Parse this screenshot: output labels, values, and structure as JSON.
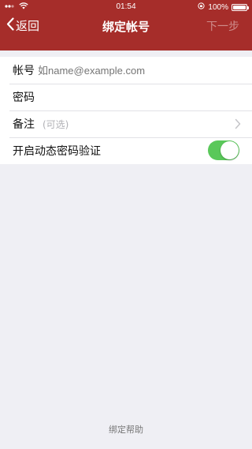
{
  "statusbar": {
    "time": "01:54",
    "battery_text": "100%"
  },
  "navbar": {
    "back_label": "返回",
    "title": "绑定帐号",
    "next_label": "下一步"
  },
  "form": {
    "account_label": "帐号",
    "account_placeholder": "如name@example.com",
    "password_label": "密码",
    "note_label": "备注",
    "note_hint": "(可选)",
    "dynamic_label": "开启动态密码验证",
    "dynamic_enabled": true
  },
  "footer": {
    "help_label": "绑定帮助"
  },
  "colors": {
    "navbar_bg": "#a62d2a",
    "toggle_on": "#5ac85a",
    "page_bg": "#efeff4"
  }
}
